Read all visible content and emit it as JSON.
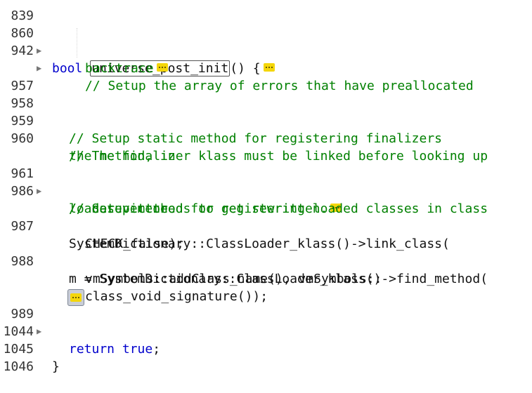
{
  "lines": {
    "l860": {
      "num": "860",
      "kw": "bool",
      "fn": "universe_post_init",
      "rest": "() {"
    },
    "l942": {
      "num": "942",
      "c1": "// Setup the array of errors that have preallocated",
      "c2": "backtrace"
    },
    "l957": {
      "num": "957"
    },
    "l958": {
      "num": "958"
    },
    "l959": {
      "num": "959",
      "text": "// Setup static method for registering finalizers"
    },
    "l960": {
      "num": "960",
      "t1": "// The finalizer klass must be linked before looking up",
      "t2": "the method, in"
    },
    "l961": {
      "num": "961",
      "text": "// case it needs to get rewritten."
    },
    "l986": {
      "num": "986",
      "t1": "// Setup method for registering loaded classes in class",
      "t2": "loader vector"
    },
    "l987": {
      "num": "987",
      "t1": "SystemDictionary::ClassLoader_klass()->link_class(",
      "t2": "CHECK_false);"
    },
    "l988": {
      "num": "988",
      "t1": "m = SystemDictionary::ClassLoader_klass()->find_method(",
      "t2": "vmSymbols::addClass_name(), vmSymbols::",
      "t3": "class_void_signature());"
    },
    "l989": {
      "num": "989"
    },
    "l1044": {
      "num": "1044",
      "kw": "return",
      "val": "true",
      "end": ";"
    },
    "l1045": {
      "num": "1045",
      "text": "}"
    }
  },
  "fold_marker": "▶"
}
